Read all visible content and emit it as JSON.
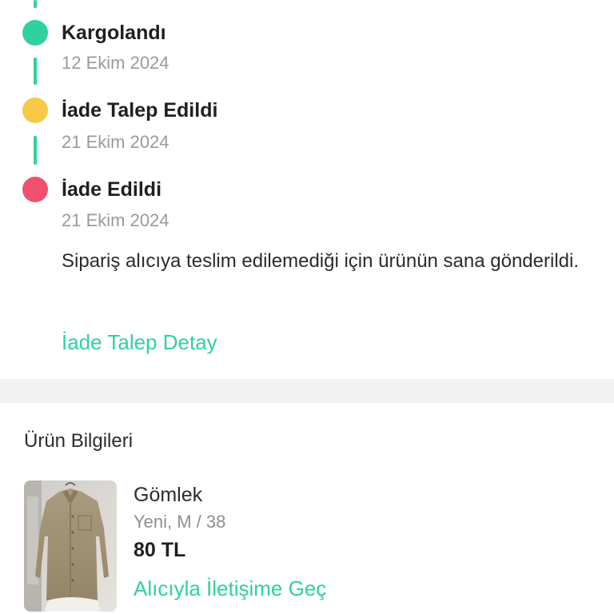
{
  "timeline": {
    "steps": [
      {
        "title": "Kargolandı",
        "date": "12 Ekim 2024",
        "color": "#2fd1a0"
      },
      {
        "title": "İade Talep Edildi",
        "date": "21 Ekim 2024",
        "color": "#f7c948"
      },
      {
        "title": "İade Edildi",
        "date": "21 Ekim 2024",
        "color": "#f0506e"
      }
    ],
    "connector_color": "#2fd1a0",
    "description": "Sipariş alıcıya teslim edilemediği için ürünün sana gönderildi.",
    "detail_link": "İade Talep Detay"
  },
  "product": {
    "section_title": "Ürün Bilgileri",
    "name": "Gömlek",
    "meta": "Yeni, M / 38",
    "price": "80 TL",
    "contact_link": "Alıcıyla İletişime Geç",
    "image_icon": "beige-shirt-photo"
  },
  "colors": {
    "accent": "#2fd1a0",
    "divider": "#f1f1f1"
  }
}
